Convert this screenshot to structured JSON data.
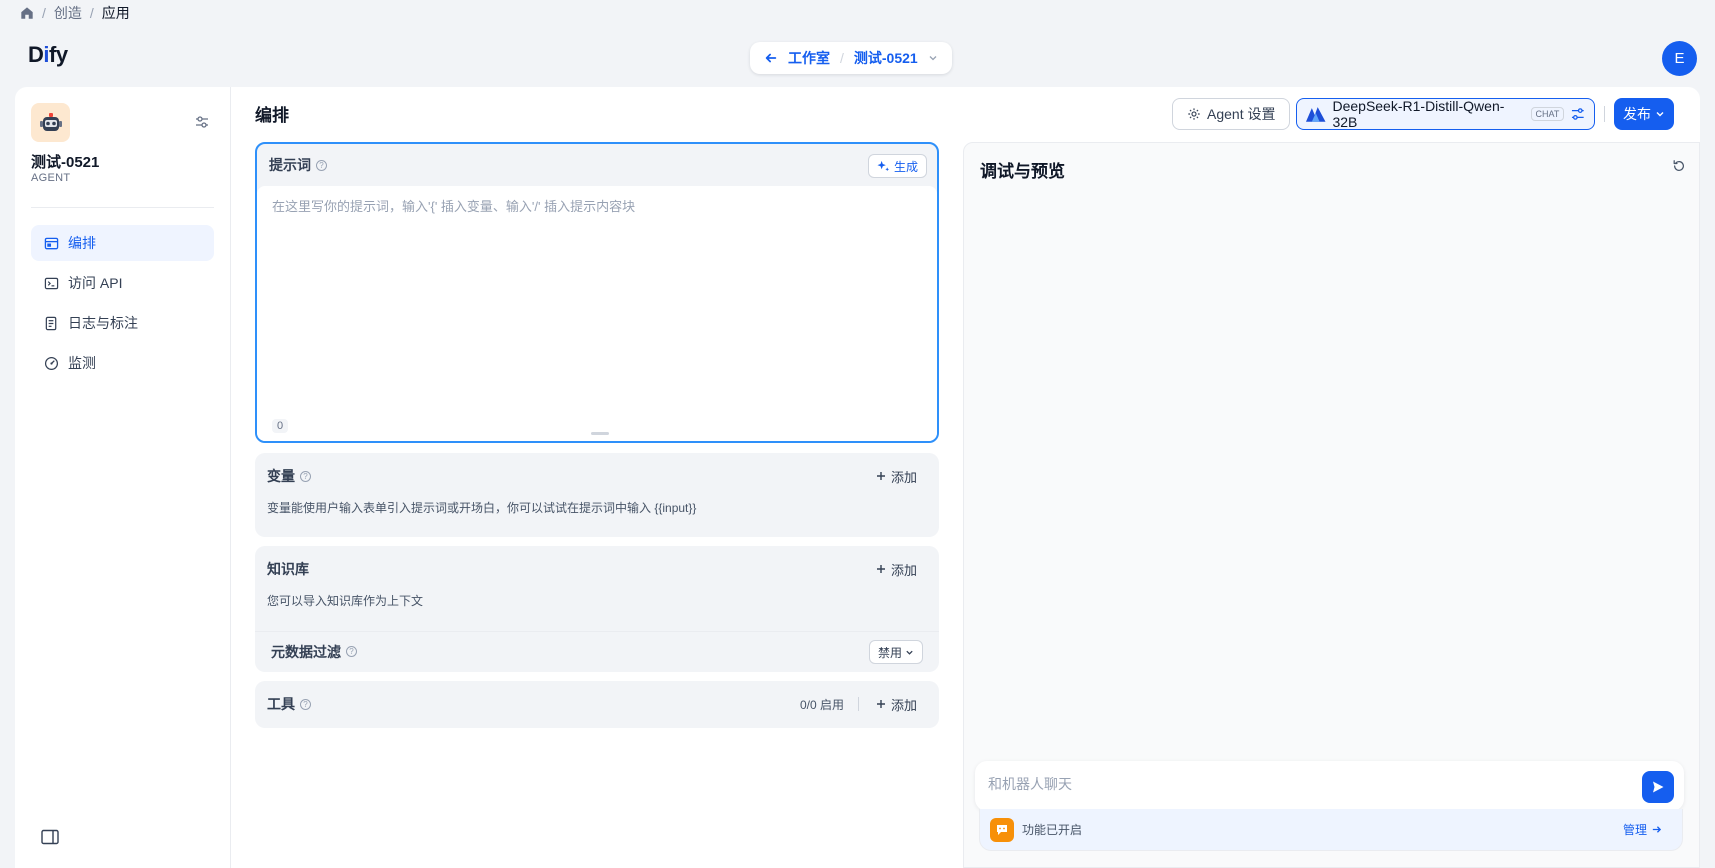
{
  "breadcrumb": {
    "items": [
      "创造",
      "应用"
    ]
  },
  "header": {
    "logo": {
      "prefix": "D",
      "accent": "i",
      "suffix": "fy"
    },
    "workspace_label": "工作室",
    "app_name": "测试-0521",
    "user_initial": "E"
  },
  "sidebar": {
    "app_name": "测试-0521",
    "app_type": "AGENT",
    "items": [
      {
        "label": "编排",
        "icon": "layout-icon",
        "active": true
      },
      {
        "label": "访问 API",
        "icon": "terminal-icon",
        "active": false
      },
      {
        "label": "日志与标注",
        "icon": "file-list-icon",
        "active": false
      },
      {
        "label": "监测",
        "icon": "gauge-icon",
        "active": false
      }
    ]
  },
  "main": {
    "title": "编排",
    "agent_settings_label": "Agent 设置",
    "model": {
      "name": "DeepSeek-R1-Distill-Qwen-32B",
      "tag": "CHAT"
    },
    "publish_label": "发布",
    "prompt": {
      "label": "提示词",
      "generate_label": "生成",
      "placeholder": "在这里写你的提示词，输入'{' 插入变量、输入'/' 插入提示内容块",
      "char_count": "0"
    },
    "variables": {
      "label": "变量",
      "add_label": "添加",
      "description": "变量能使用户输入表单引入提示词或开场白，你可以试试在提示词中输入 {{input}}"
    },
    "knowledge": {
      "label": "知识库",
      "add_label": "添加",
      "description": "您可以导入知识库作为上下文",
      "metadata_filter_label": "元数据过滤",
      "metadata_filter_value": "禁用"
    },
    "tools": {
      "label": "工具",
      "status": "0/0 启用",
      "add_label": "添加"
    }
  },
  "debug": {
    "title": "调试与预览",
    "chat_placeholder": "和机器人聊天",
    "feature_status": "功能已开启",
    "manage_label": "管理"
  },
  "colors": {
    "primary": "#155eef",
    "active_nav_bg": "#eff4ff",
    "prompt_border": "#2e90fa",
    "feature_icon": "#f79009"
  }
}
